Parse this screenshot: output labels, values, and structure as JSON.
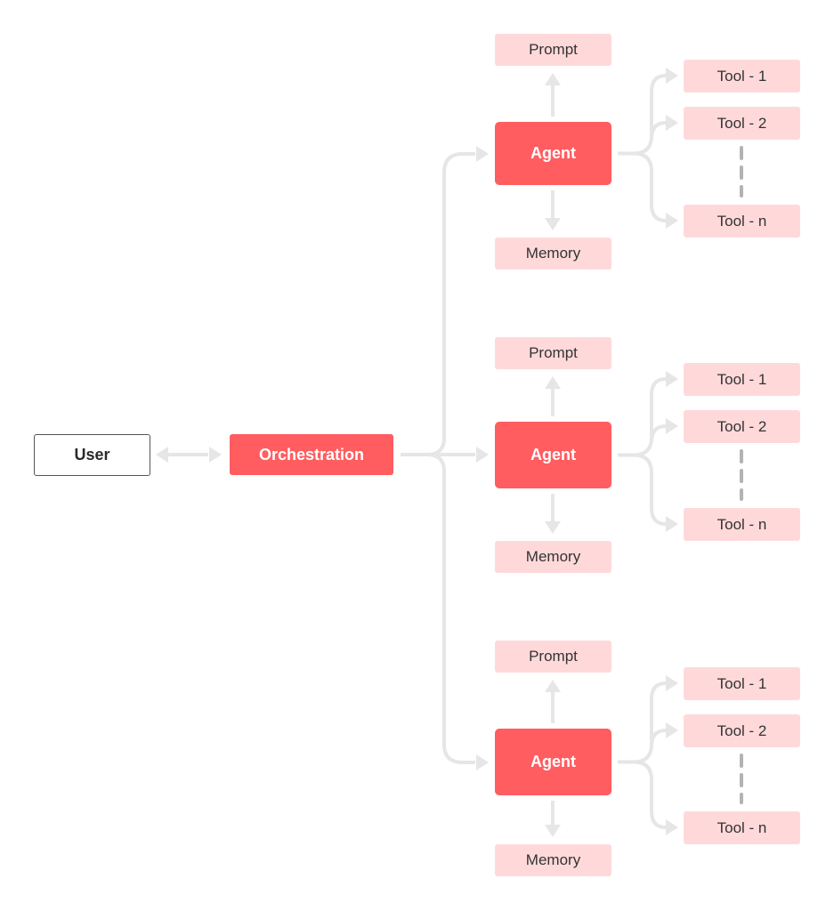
{
  "diagram": {
    "user": {
      "label": "User"
    },
    "orchestration": {
      "label": "Orchestration"
    },
    "agents": [
      {
        "label": "Agent",
        "prompt": "Prompt",
        "memory": "Memory",
        "tools": [
          "Tool - 1",
          "Tool - 2",
          "Tool - n"
        ]
      },
      {
        "label": "Agent",
        "prompt": "Prompt",
        "memory": "Memory",
        "tools": [
          "Tool - 1",
          "Tool - 2",
          "Tool - n"
        ]
      },
      {
        "label": "Agent",
        "prompt": "Prompt",
        "memory": "Memory",
        "tools": [
          "Tool - 1",
          "Tool - 2",
          "Tool - n"
        ]
      }
    ],
    "colors": {
      "primary": "#ff5d60",
      "light": "#ffd9da",
      "connector": "#e6e6e6",
      "dashed": "#b3b3b3",
      "user_border": "#555555"
    }
  }
}
